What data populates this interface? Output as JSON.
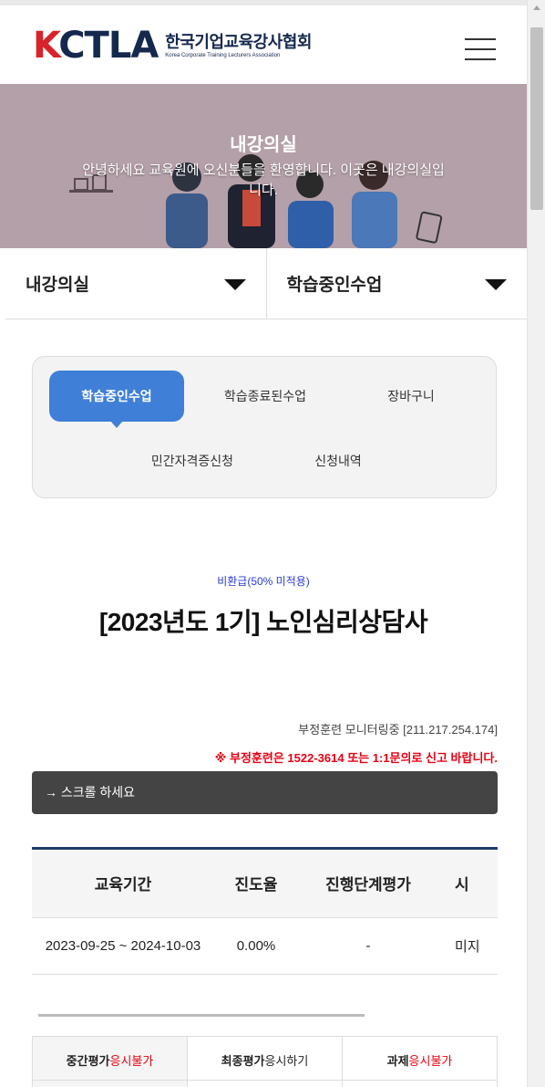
{
  "header": {
    "logo_mark": "KCTLA",
    "logo_korean": "한국기업교육강사협회",
    "logo_english": "Korea Corporate Training Lecturers Association",
    "menu_icon": "hamburger-menu-icon"
  },
  "banner": {
    "title": "내강의실",
    "description": "안녕하세요 교육원에 오신분들을 환영합니다. 이곳은 내강의실입니다.",
    "background_color": "#b4a0a8"
  },
  "select_bar": {
    "left_label": "내강의실",
    "right_label": "학습중인수업"
  },
  "tabs": {
    "items": [
      {
        "label": "학습중인수업",
        "active": true
      },
      {
        "label": "학습종료된수업",
        "active": false
      },
      {
        "label": "장바구니",
        "active": false
      },
      {
        "label": "민간자격증신청",
        "active": false
      },
      {
        "label": "신청내역",
        "active": false
      }
    ],
    "accent_color": "#3f7fd7"
  },
  "course": {
    "badge": "비환급(50% 미적용)",
    "title": "[2023년도 1기] 노인심리상담사"
  },
  "monitor_text": "부정훈련 모니터링중 [211.217.254.174]",
  "warning_text": "※ 부정훈련은 1522-3614 또는 1:1문의로 신고 바랍니다.",
  "scroll_hint": "→ 스크롤 하세요",
  "info_table": {
    "headers": [
      "교육기간",
      "진도율",
      "진행단계평가",
      "시"
    ],
    "row": [
      "2023-09-25 ~ 2024-10-03",
      "0.00%",
      "-",
      "미지"
    ]
  },
  "eval_table": {
    "cells": [
      {
        "label": "중간평가",
        "status": "응시불가"
      },
      {
        "label": "최종평가",
        "status": "응시하기"
      },
      {
        "label": "과제",
        "status": "응시불가"
      }
    ]
  },
  "colors": {
    "brand_navy": "#15284e",
    "brand_red": "#d8232a",
    "warning_red": "#e60012",
    "table_border": "#1e3a66"
  }
}
